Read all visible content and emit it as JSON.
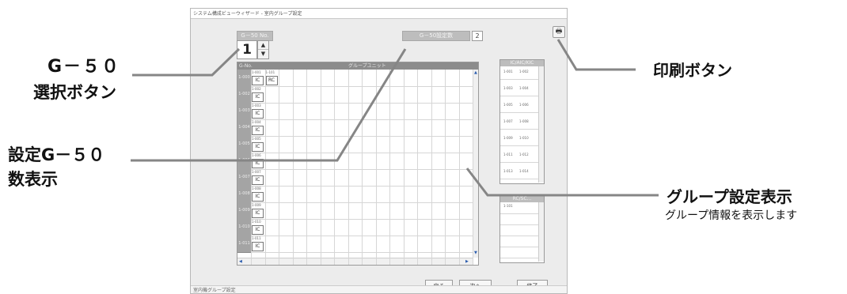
{
  "window": {
    "title": "システム構成ビューウィザード - 室内グループ設定",
    "status": "室内機グループ設定"
  },
  "g50_no": {
    "label": "G－50 No.",
    "value": "1",
    "spin_up": "▲",
    "spin_down": "▼"
  },
  "g50_setting": {
    "label": "G－50設定数",
    "value": "2"
  },
  "print_icon": "🖶",
  "grid": {
    "corner": "G-No.",
    "title": "グループユニット",
    "rows": [
      "1-000",
      "1-002",
      "1-003",
      "1-004",
      "1-005",
      "1-006",
      "1-007",
      "1-008",
      "1-009",
      "1-010",
      "1-011"
    ],
    "cells": [
      [
        {
          "addr": "1-001",
          "type": "IC"
        },
        {
          "addr": "1-101",
          "type": "RC"
        }
      ],
      [
        {
          "addr": "1-002",
          "type": "IC"
        }
      ],
      [
        {
          "addr": "1-003",
          "type": "IC"
        }
      ],
      [
        {
          "addr": "1-004",
          "type": "IC"
        }
      ],
      [
        {
          "addr": "1-005",
          "type": "IC"
        }
      ],
      [
        {
          "addr": "1-006",
          "type": "IC"
        }
      ],
      [
        {
          "addr": "1-007",
          "type": "IC"
        }
      ],
      [
        {
          "addr": "1-008",
          "type": "IC"
        }
      ],
      [
        {
          "addr": "1-009",
          "type": "IC"
        }
      ],
      [
        {
          "addr": "1-010",
          "type": "IC"
        }
      ],
      [
        {
          "addr": "1-011",
          "type": "IC"
        }
      ]
    ]
  },
  "ic_panel": {
    "title": "IC/AIC/KIC",
    "items": [
      "1-001",
      "1-002",
      "1-003",
      "1-004",
      "1-005",
      "1-006",
      "1-007",
      "1-008",
      "1-009",
      "1-010",
      "1-011",
      "1-012",
      "1-013",
      "1-014"
    ]
  },
  "rc_panel": {
    "title": "RC/SC...",
    "items": [
      "1-101"
    ]
  },
  "buttons": {
    "back": "戻る",
    "next": "次へ",
    "finish": "終了"
  },
  "callouts": {
    "g50_select_line1": "G－５０",
    "g50_select_line2": "選択ボタン",
    "g50_count_line1": "設定G－５０",
    "g50_count_line2": "数表示",
    "print": "印刷ボタン",
    "group": "グループ設定表示",
    "group_sub": "グループ情報を表示します"
  }
}
